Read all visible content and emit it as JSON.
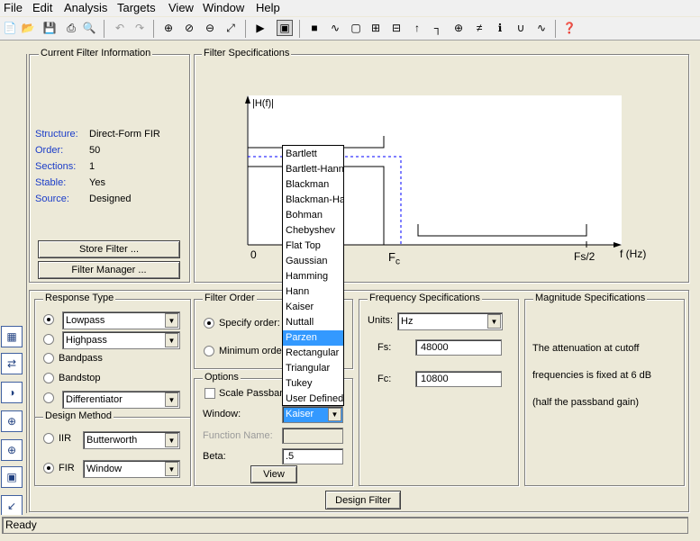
{
  "menu": {
    "file": "File",
    "edit": "Edit",
    "analysis": "Analysis",
    "targets": "Targets",
    "view": "View",
    "window": "Window",
    "help": "Help"
  },
  "filter_info": {
    "title": "Current Filter Information",
    "rows": [
      {
        "label": "Structure:",
        "value": "Direct-Form FIR"
      },
      {
        "label": "Order:",
        "value": "50"
      },
      {
        "label": "Sections:",
        "value": "1"
      },
      {
        "label": "Stable:",
        "value": "Yes"
      },
      {
        "label": "Source:",
        "value": "Designed"
      }
    ],
    "store_button": "Store Filter ...",
    "manager_button": "Filter Manager ..."
  },
  "filter_spec": {
    "title": "Filter Specifications",
    "y_label": "|H(f)|",
    "origin_label": "0",
    "fc_label": "F",
    "fc_sub": "c",
    "fs2_label": "Fs/2",
    "x_label": "f (Hz)"
  },
  "response_type": {
    "title": "Response Type",
    "lowpass": "Lowpass",
    "highpass": "Highpass",
    "bandpass": "Bandpass",
    "bandstop": "Bandstop",
    "differentiator": "Differentiator"
  },
  "design_method": {
    "title": "Design Method",
    "iir_label": "IIR",
    "iir_value": "Butterworth",
    "fir_label": "FIR",
    "fir_value": "Window"
  },
  "filter_order": {
    "title": "Filter Order",
    "specify": "Specify order:",
    "minimum": "Minimum order"
  },
  "options": {
    "title": "Options",
    "scale_passband": "Scale Passband",
    "window_label": "Window:",
    "window_value": "Kaiser",
    "function_name_label": "Function Name:",
    "beta_label": "Beta:",
    "beta_value": ".5",
    "view_button": "View"
  },
  "window_dropdown": {
    "items": [
      "Bartlett",
      "Bartlett-Hanning",
      "Blackman",
      "Blackman-Harris",
      "Bohman",
      "Chebyshev",
      "Flat Top",
      "Gaussian",
      "Hamming",
      "Hann",
      "Kaiser",
      "Nuttall",
      "Parzen",
      "Rectangular",
      "Triangular",
      "Tukey",
      "User Defined"
    ],
    "highlighted": "Parzen"
  },
  "freq_spec": {
    "title": "Frequency Specifications",
    "units_label": "Units:",
    "units_value": "Hz",
    "fs_label": "Fs:",
    "fs_value": "48000",
    "fc_label": "Fc:",
    "fc_value": "10800"
  },
  "mag_spec": {
    "title": "Magnitude Specifications",
    "line1": "The attenuation at cutoff",
    "line2": "frequencies is fixed at 6 dB",
    "line3": "(half the passband gain)"
  },
  "design_button": "Design Filter",
  "status": "Ready",
  "colors": {
    "accent": "#3399ff",
    "info_label": "#1a3cc8",
    "dialog_bg": "#ece9d8"
  }
}
